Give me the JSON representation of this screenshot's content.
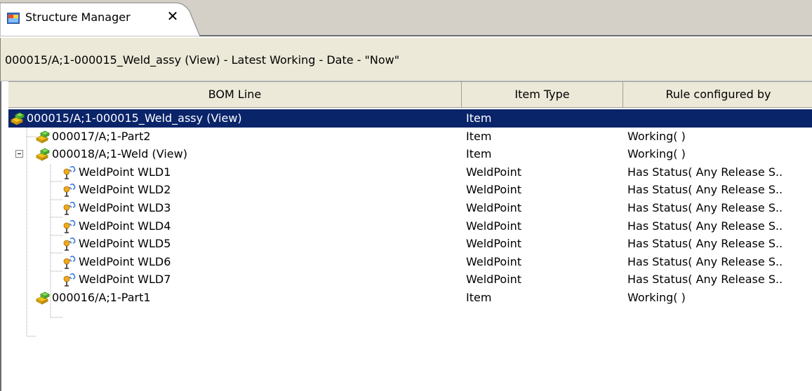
{
  "tab": {
    "title": "Structure Manager",
    "close_glyph": "✕",
    "icon": "structure-manager-icon"
  },
  "header": {
    "context": "000015/A;1-000015_Weld_assy (View) - Latest Working - Date - \"Now\""
  },
  "table": {
    "columns": [
      "BOM Line",
      "Item Type",
      "Rule configured by"
    ],
    "rows": [
      {
        "name": "000015/A;1-000015_Weld_assy (View)",
        "type": "Item",
        "rule": "",
        "icon": "assembly-icon",
        "selected": true
      },
      {
        "name": "000017/A;1-Part2",
        "type": "Item",
        "rule": "Working( )",
        "icon": "assembly-icon"
      },
      {
        "name": "000018/A;1-Weld (View)",
        "type": "Item",
        "rule": "Working( )",
        "icon": "assembly-icon"
      },
      {
        "name": "WeldPoint WLD1",
        "type": "WeldPoint",
        "rule": "Has Status( Any Release S..",
        "icon": "weldpoint-icon"
      },
      {
        "name": "WeldPoint WLD2",
        "type": "WeldPoint",
        "rule": "Has Status( Any Release S..",
        "icon": "weldpoint-icon"
      },
      {
        "name": "WeldPoint WLD3",
        "type": "WeldPoint",
        "rule": "Has Status( Any Release S..",
        "icon": "weldpoint-icon"
      },
      {
        "name": "WeldPoint WLD4",
        "type": "WeldPoint",
        "rule": "Has Status( Any Release S..",
        "icon": "weldpoint-icon"
      },
      {
        "name": "WeldPoint WLD5",
        "type": "WeldPoint",
        "rule": "Has Status( Any Release S..",
        "icon": "weldpoint-icon"
      },
      {
        "name": "WeldPoint WLD6",
        "type": "WeldPoint",
        "rule": "Has Status( Any Release S..",
        "icon": "weldpoint-icon"
      },
      {
        "name": "WeldPoint WLD7",
        "type": "WeldPoint",
        "rule": "Has Status( Any Release S..",
        "icon": "weldpoint-icon"
      },
      {
        "name": "000016/A;1-Part1",
        "type": "Item",
        "rule": "Working( )",
        "icon": "assembly-icon"
      }
    ]
  },
  "colors": {
    "selection": "#0a246a",
    "chrome": "#ece9d8",
    "tab_strip": "#d4d0c8"
  }
}
